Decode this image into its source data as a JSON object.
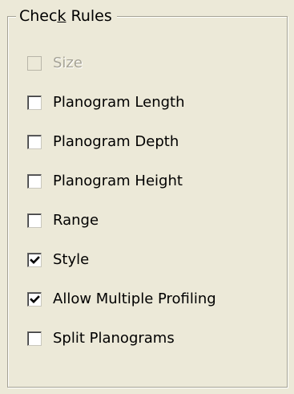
{
  "group": {
    "title_prefix": "Chec",
    "title_accel": "k",
    "title_suffix": " Rules"
  },
  "rules": [
    {
      "label": "Size",
      "checked": false,
      "enabled": false
    },
    {
      "label": "Planogram Length",
      "checked": false,
      "enabled": true
    },
    {
      "label": "Planogram Depth",
      "checked": false,
      "enabled": true
    },
    {
      "label": "Planogram Height",
      "checked": false,
      "enabled": true
    },
    {
      "label": "Range",
      "checked": false,
      "enabled": true
    },
    {
      "label": "Style",
      "checked": true,
      "enabled": true
    },
    {
      "label": "Allow Multiple Profiling",
      "checked": true,
      "enabled": true
    },
    {
      "label": "Split Planograms",
      "checked": false,
      "enabled": true
    }
  ],
  "colors": {
    "background": "#ece9d8",
    "disabled_text": "#a6a396",
    "check_mark": "#000000"
  }
}
